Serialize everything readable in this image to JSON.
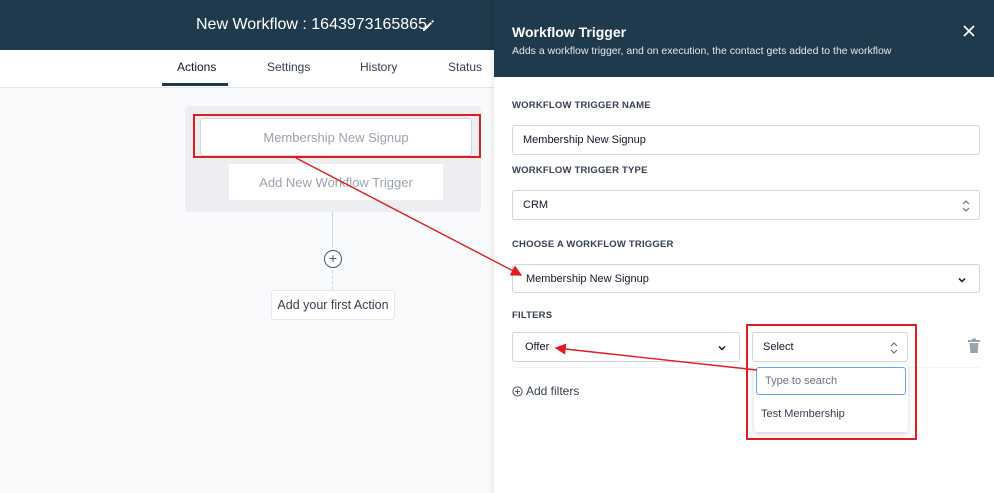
{
  "header": {
    "workflow_title": "New Workflow : 1643973165865"
  },
  "tabs": [
    {
      "label": "Actions",
      "active": true
    },
    {
      "label": "Settings",
      "active": false
    },
    {
      "label": "History",
      "active": false
    },
    {
      "label": "Status",
      "active": false
    }
  ],
  "canvas": {
    "trigger_card": "Membership New Signup",
    "add_trigger": "Add New Workflow Trigger",
    "first_action": "Add your first Action"
  },
  "drawer": {
    "title": "Workflow Trigger",
    "subtitle": "Adds a workflow trigger, and on execution, the contact gets added to the workflow",
    "name_label": "WORKFLOW TRIGGER NAME",
    "name_value": "Membership New Signup",
    "type_label": "WORKFLOW TRIGGER TYPE",
    "type_value": "CRM",
    "choose_label": "CHOOSE A WORKFLOW TRIGGER",
    "choose_value": "Membership New Signup",
    "filters_label": "FILTERS",
    "filter_field": "Offer",
    "filter_value": "Select",
    "add_filters": "Add filters",
    "search_placeholder": "Type to search",
    "options": [
      "Test Membership"
    ]
  },
  "colors": {
    "header_bg": "#1e3a4c",
    "highlight": "#e11d22"
  }
}
